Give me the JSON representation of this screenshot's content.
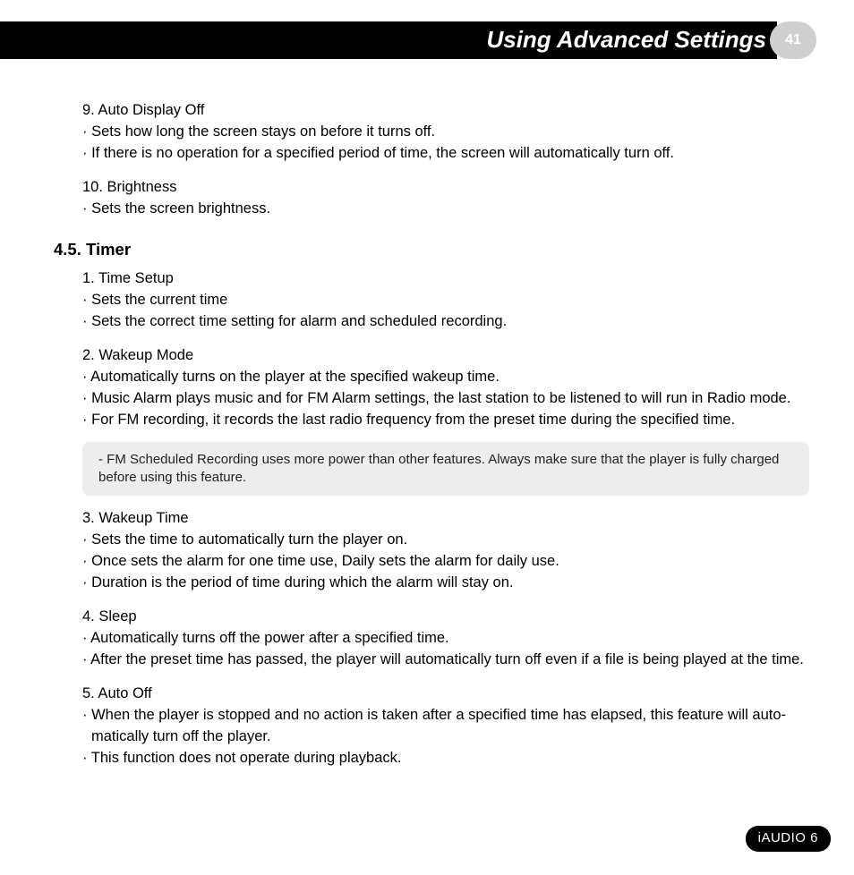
{
  "header": {
    "title": "Using Advanced Settings",
    "page_number": "41"
  },
  "intro_items": [
    {
      "title": "9. Auto Display Off",
      "bullets": [
        "Sets how long the screen stays on before it turns off.",
        "If there is no operation for a specified period of time, the screen will automatically turn off."
      ]
    },
    {
      "title": "10. Brightness",
      "bullets": [
        "Sets the screen brightness."
      ]
    }
  ],
  "section": {
    "heading": "4.5. Timer",
    "items_pre": [
      {
        "title": "1. Time Setup",
        "bullets": [
          "Sets the current time",
          "Sets the correct time setting for alarm and scheduled recording."
        ]
      },
      {
        "title": "2. Wakeup Mode",
        "bullets": [
          "Automatically turns on the player at the specified wakeup time.",
          "Music Alarm plays music and for FM Alarm settings, the last station to be listened to will run in Radio mode.",
          "For FM recording, it records the last radio frequency from the preset time during the specified time."
        ]
      }
    ],
    "note": "- FM Scheduled Recording uses more power than other features. Always make sure that the player is fully charged before using this feature.",
    "items_post": [
      {
        "title": "3. Wakeup Time",
        "bullets": [
          "Sets the time to automatically turn the player on.",
          "Once sets the alarm for one time use, Daily sets the alarm for daily use.",
          "Duration is the period of time during which the alarm will stay on."
        ]
      },
      {
        "title": "4. Sleep",
        "bullets": [
          "Automatically turns off the power after a specified time.",
          "After the preset time has passed, the player will automatically turn off even if a file is being played at the time."
        ]
      },
      {
        "title": "5. Auto Off",
        "bullets": [
          "When the player is stopped and no action is taken after a specified time has elapsed, this feature will auto-matically turn off the player.",
          "This function does not operate during playback."
        ]
      }
    ]
  },
  "footer": {
    "badge": "iAUDIO 6"
  }
}
